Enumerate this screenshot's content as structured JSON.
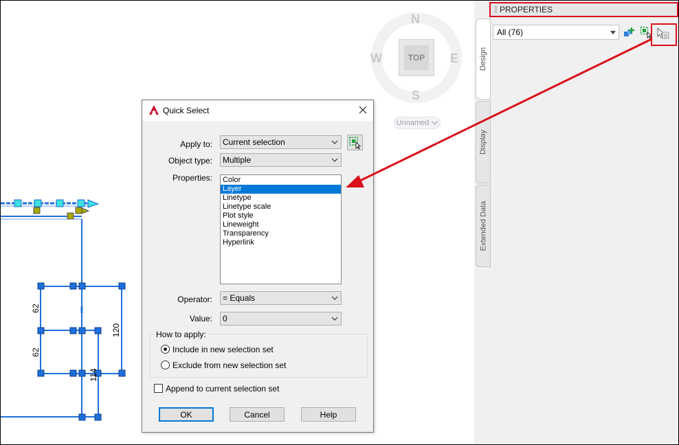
{
  "viewcube": {
    "north": "N",
    "south": "S",
    "east": "E",
    "west": "W",
    "face": "TOP",
    "ucs_menu": "Unnamed"
  },
  "properties_panel": {
    "title": "PROPERTIES",
    "filter_value": "All (76)",
    "tabs": [
      "Design",
      "Display",
      "Extended Data"
    ],
    "icons": [
      "select-objects-icon",
      "pickadd-icon",
      "quick-select-icon"
    ]
  },
  "drawing": {
    "dimension_labels": [
      "62",
      "62",
      "120",
      "114"
    ]
  },
  "dialog": {
    "title": "Quick Select",
    "apply_to": {
      "label": "Apply to:",
      "value": "Current selection"
    },
    "object_type": {
      "label": "Object type:",
      "value": "Multiple"
    },
    "properties": {
      "label": "Properties:",
      "items": [
        "Color",
        "Layer",
        "Linetype",
        "Linetype scale",
        "Plot style",
        "Lineweight",
        "Transparency",
        "Hyperlink"
      ],
      "selected": "Layer"
    },
    "operator": {
      "label": "Operator:",
      "value": "= Equals"
    },
    "value": {
      "label": "Value:",
      "value": "0"
    },
    "how_to_apply": {
      "legend": "How to apply:",
      "include": "Include in new selection set",
      "exclude": "Exclude from new selection set",
      "selected": "include"
    },
    "append_label": "Append to current selection set",
    "append_checked": false,
    "buttons": {
      "ok": "OK",
      "cancel": "Cancel",
      "help": "Help"
    }
  },
  "colors": {
    "annotation_red": "#d9101c",
    "selection_blue": "#0078d7",
    "grip_blue": "#1e6fd9",
    "grip_cyan": "#3fe0e0",
    "grip_olive": "#a7a700"
  }
}
